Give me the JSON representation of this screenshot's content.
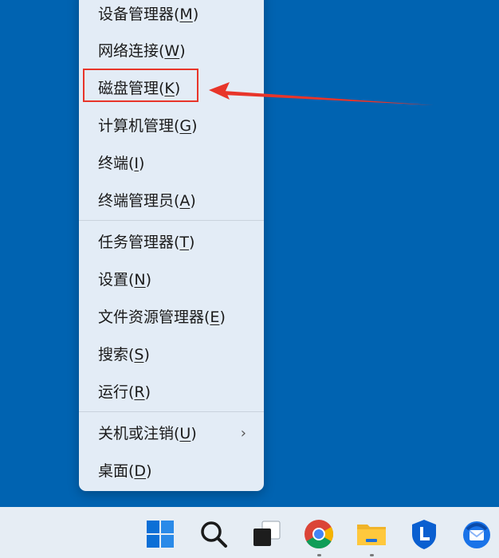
{
  "menu": {
    "items": [
      {
        "label": "设备管理器(",
        "key": "M",
        "suffix": ")"
      },
      {
        "label": "网络连接(",
        "key": "W",
        "suffix": ")"
      },
      {
        "label": "磁盘管理(",
        "key": "K",
        "suffix": ")"
      },
      {
        "label": "计算机管理(",
        "key": "G",
        "suffix": ")"
      },
      {
        "label": "终端(",
        "key": "I",
        "suffix": ")"
      },
      {
        "label": "终端管理员(",
        "key": "A",
        "suffix": ")"
      },
      {
        "label": "任务管理器(",
        "key": "T",
        "suffix": ")"
      },
      {
        "label": "设置(",
        "key": "N",
        "suffix": ")"
      },
      {
        "label": "文件资源管理器(",
        "key": "E",
        "suffix": ")"
      },
      {
        "label": "搜索(",
        "key": "S",
        "suffix": ")"
      },
      {
        "label": "运行(",
        "key": "R",
        "suffix": ")"
      },
      {
        "label": "关机或注销(",
        "key": "U",
        "suffix": ")",
        "chevron": "›"
      },
      {
        "label": "桌面(",
        "key": "D",
        "suffix": ")"
      }
    ]
  },
  "annotation": {
    "highlight_color": "#e8352a",
    "target": "磁盘管理(K)"
  },
  "taskbar": {
    "icons": [
      "windows-start-icon",
      "search-icon",
      "task-view-icon",
      "chrome-icon",
      "file-explorer-icon",
      "bing-icon",
      "thunderbird-icon"
    ]
  },
  "colors": {
    "desktop": "#0063b1",
    "menu_bg": "#e3ecf6",
    "taskbar_bg": "#e6edf4"
  }
}
